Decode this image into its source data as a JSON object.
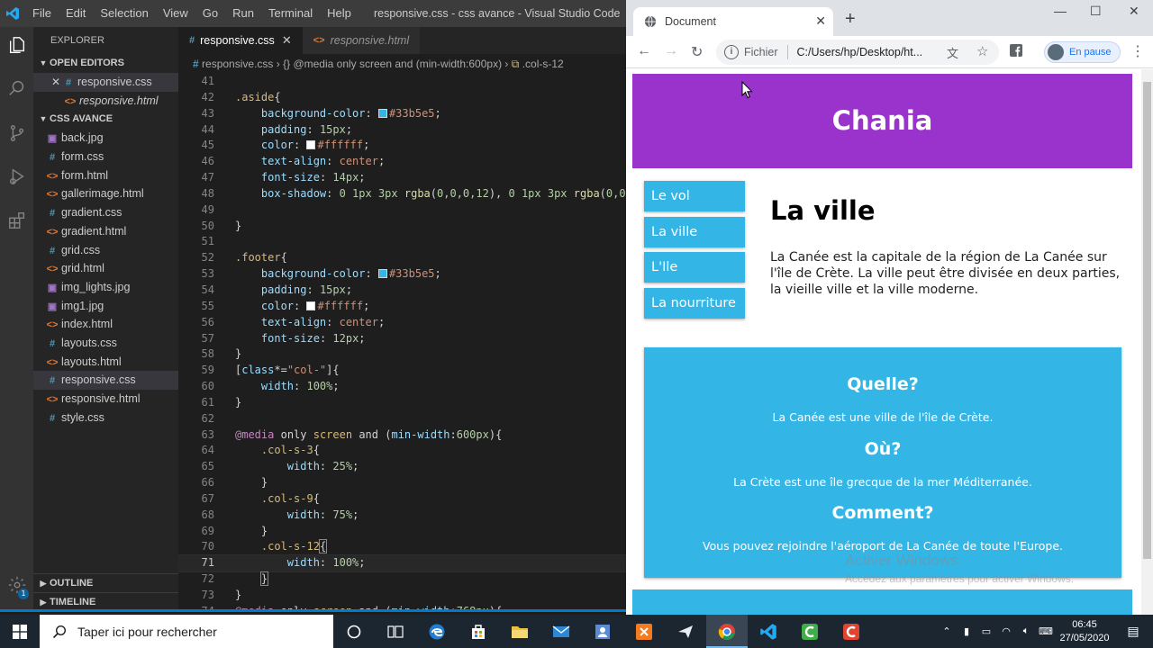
{
  "vscode": {
    "menu": [
      "File",
      "Edit",
      "Selection",
      "View",
      "Go",
      "Run",
      "Terminal",
      "Help"
    ],
    "window_title": "responsive.css - css avance - Visual Studio Code",
    "explorer_title": "EXPLORER",
    "open_editors_label": "OPEN EDITORS",
    "open_editors": [
      {
        "name": "responsive.css",
        "type": "css",
        "selected": true,
        "italic": false
      },
      {
        "name": "responsive.html",
        "type": "html",
        "selected": false,
        "italic": true
      }
    ],
    "folder_label": "CSS AVANCE",
    "files": [
      {
        "name": "back.jpg",
        "type": "img"
      },
      {
        "name": "form.css",
        "type": "css"
      },
      {
        "name": "form.html",
        "type": "html"
      },
      {
        "name": "gallerimage.html",
        "type": "html"
      },
      {
        "name": "gradient.css",
        "type": "css"
      },
      {
        "name": "gradient.html",
        "type": "html"
      },
      {
        "name": "grid.css",
        "type": "css"
      },
      {
        "name": "grid.html",
        "type": "html"
      },
      {
        "name": "img_lights.jpg",
        "type": "img"
      },
      {
        "name": "img1.jpg",
        "type": "img"
      },
      {
        "name": "index.html",
        "type": "html"
      },
      {
        "name": "layouts.css",
        "type": "css"
      },
      {
        "name": "layouts.html",
        "type": "html"
      },
      {
        "name": "responsive.css",
        "type": "css",
        "selected": true
      },
      {
        "name": "responsive.html",
        "type": "html"
      },
      {
        "name": "style.css",
        "type": "css"
      }
    ],
    "outline_label": "OUTLINE",
    "timeline_label": "TIMELINE",
    "badge_count": "1",
    "tabs": [
      {
        "name": "responsive.css",
        "type": "css",
        "active": true,
        "italic": false
      },
      {
        "name": "responsive.html",
        "type": "html",
        "active": false,
        "italic": true
      }
    ],
    "breadcrumb": {
      "file": "responsive.css",
      "media": "@media only screen and (min-width:600px)",
      "selector": ".col-s-12"
    },
    "code_lines": [
      {
        "n": "41",
        "html": ""
      },
      {
        "n": "42",
        "html": "<span class=\"sel-c\">.aside</span><span class=\"punc\">{</span>"
      },
      {
        "n": "43",
        "html": "    <span class=\"prop\">background-color</span>: <span class=\"swatch\" style=\"background:#33b5e5\"></span><span class=\"val\">#33b5e5</span>;"
      },
      {
        "n": "44",
        "html": "    <span class=\"prop\">padding</span>: <span class=\"num\">15px</span>;"
      },
      {
        "n": "45",
        "html": "    <span class=\"prop\">color</span>: <span class=\"swatch\" style=\"background:#ffffff\"></span><span class=\"val\">#ffffff</span>;"
      },
      {
        "n": "46",
        "html": "    <span class=\"prop\">text-align</span>: <span class=\"val\">center</span>;"
      },
      {
        "n": "47",
        "html": "    <span class=\"prop\">font-size</span>: <span class=\"num\">14px</span>;"
      },
      {
        "n": "48",
        "html": "    <span class=\"prop\">box-shadow</span>: <span class=\"num\">0 1px 3px</span> <span class=\"fn\">rgba</span>(<span class=\"num\">0,0,0,12</span>), <span class=\"num\">0 1px 3px</span> <span class=\"fn\">rgba</span>(<span class=\"num\">0,0,0,</span>"
      },
      {
        "n": "49",
        "html": ""
      },
      {
        "n": "50",
        "html": "<span class=\"punc\">}</span>"
      },
      {
        "n": "51",
        "html": ""
      },
      {
        "n": "52",
        "html": "<span class=\"sel-c\">.footer</span><span class=\"punc\">{</span>"
      },
      {
        "n": "53",
        "html": "    <span class=\"prop\">background-color</span>: <span class=\"swatch\" style=\"background:#33b5e5\"></span><span class=\"val\">#33b5e5</span>;"
      },
      {
        "n": "54",
        "html": "    <span class=\"prop\">padding</span>: <span class=\"num\">15px</span>;"
      },
      {
        "n": "55",
        "html": "    <span class=\"prop\">color</span>: <span class=\"swatch\" style=\"background:#ffffff\"></span><span class=\"val\">#ffffff</span>;"
      },
      {
        "n": "56",
        "html": "    <span class=\"prop\">text-align</span>: <span class=\"val\">center</span>;"
      },
      {
        "n": "57",
        "html": "    <span class=\"prop\">font-size</span>: <span class=\"num\">12px</span>;"
      },
      {
        "n": "58",
        "html": "<span class=\"punc\">}</span>"
      },
      {
        "n": "59",
        "html": "<span class=\"punc\">[</span><span class=\"prop\">class</span>*=<span class=\"val\">\"col-\"</span><span class=\"punc\">]{</span>"
      },
      {
        "n": "60",
        "html": "    <span class=\"prop\">width</span>: <span class=\"num\">100%</span>;"
      },
      {
        "n": "61",
        "html": "<span class=\"punc\">}</span>"
      },
      {
        "n": "62",
        "html": ""
      },
      {
        "n": "63",
        "html": "<span class=\"kw\">@media</span> <span class=\"punc\">only</span> <span class=\"sel-c\">screen</span> <span class=\"punc\">and</span> (<span class=\"prop\">min-width</span>:<span class=\"num\">600px</span>){"
      },
      {
        "n": "64",
        "html": "    <span class=\"sel-c\">.col-s-3</span>{"
      },
      {
        "n": "65",
        "html": "        <span class=\"prop\">width</span>: <span class=\"num\">25%</span>;"
      },
      {
        "n": "66",
        "html": "    <span class=\"punc\">}</span>"
      },
      {
        "n": "67",
        "html": "    <span class=\"sel-c\">.col-s-9</span>{"
      },
      {
        "n": "68",
        "html": "        <span class=\"prop\">width</span>: <span class=\"num\">75%</span>;"
      },
      {
        "n": "69",
        "html": "    <span class=\"punc\">}</span>"
      },
      {
        "n": "70",
        "html": "    <span class=\"sel-c\">.col-s-12</span><span style=\"outline:1px solid #888\">{</span>"
      },
      {
        "n": "71",
        "html": "        <span class=\"prop\">width</span>: <span class=\"num\">100%</span>;",
        "current": true
      },
      {
        "n": "72",
        "html": "    <span style=\"outline:1px solid #888\">}</span>"
      },
      {
        "n": "73",
        "html": "<span class=\"punc\">}</span>"
      },
      {
        "n": "74",
        "html": "<span class=\"kw\">@media</span> <span class=\"punc\">only</span> <span class=\"sel-c\">screen</span> <span class=\"punc\">and</span> (<span class=\"prop\">min-width</span>:<span class=\"num\">768px</span>){"
      }
    ]
  },
  "chrome": {
    "tab_title": "Document",
    "omnibox_scheme": "Fichier",
    "omnibox_url": "C:/Users/hp/Desktop/ht...",
    "profile_label": "En pause",
    "page": {
      "header": "Chania",
      "menu": [
        "Le vol",
        "La ville",
        "L'Ile",
        "La nourriture"
      ],
      "main_title": "La ville",
      "main_text": "La Canée est la capitale de la région de La Canée sur l'île de Crète. La ville peut être divisée en deux parties, la vieille ville et la ville moderne.",
      "aside": [
        {
          "title": "Quelle?",
          "text": "La Canée est une ville de l'île de Crète."
        },
        {
          "title": "Où?",
          "text": "La Crète est une île grecque de la mer Méditerranée."
        },
        {
          "title": "Comment?",
          "text": "Vous pouvez rejoindre l'aéroport de La Canée de toute l'Europe."
        }
      ]
    },
    "watermark_title": "Activer Windows",
    "watermark_text": "Accédez aux paramètres pour activer Windows."
  },
  "taskbar": {
    "search_placeholder": "Taper ici pour rechercher",
    "time": "06:45",
    "date": "27/05/2020"
  },
  "colors": {
    "header": "#9933cc",
    "accent": "#33b5e5",
    "vscode_blue": "#007acc"
  }
}
